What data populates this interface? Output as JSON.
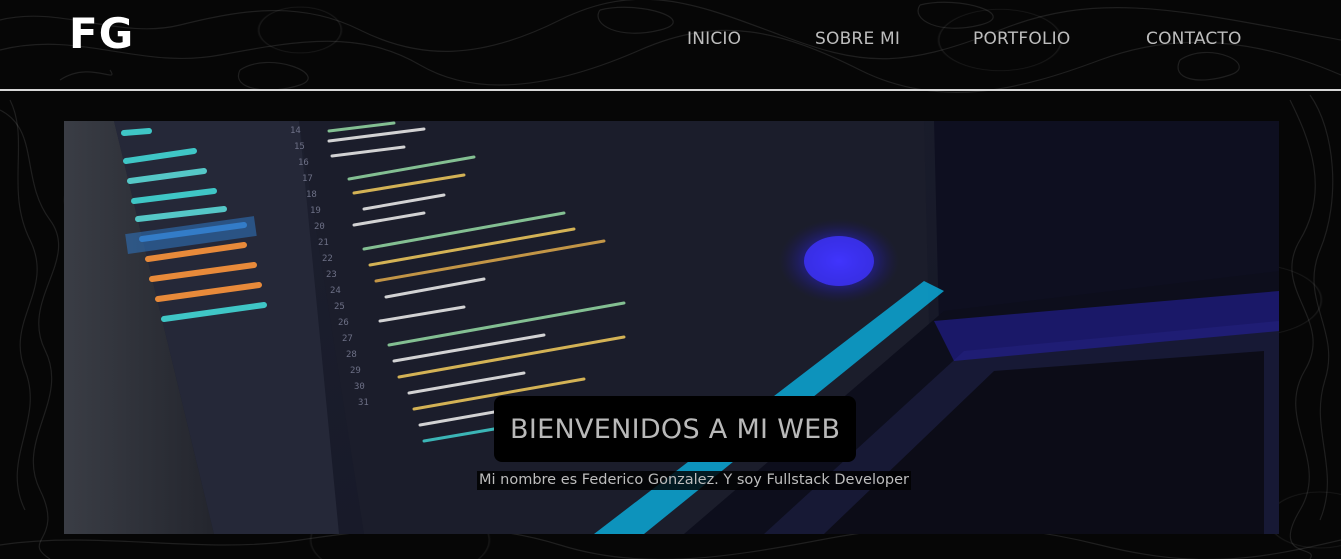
{
  "header": {
    "logo_text": "FG",
    "nav": [
      {
        "label": "INICIO"
      },
      {
        "label": "SOBRE MI"
      },
      {
        "label": "PORTFOLIO"
      },
      {
        "label": "CONTACTO"
      }
    ]
  },
  "hero": {
    "title": "BIENVENIDOS A MI WEB",
    "subtitle": "Mi nombre es Federico Gonzalez. Y soy Fullstack Developer"
  },
  "colors": {
    "background": "#060606",
    "nav_text": "#bdbdbd",
    "divider": "#d6d6d6",
    "title_box": "#000000"
  }
}
